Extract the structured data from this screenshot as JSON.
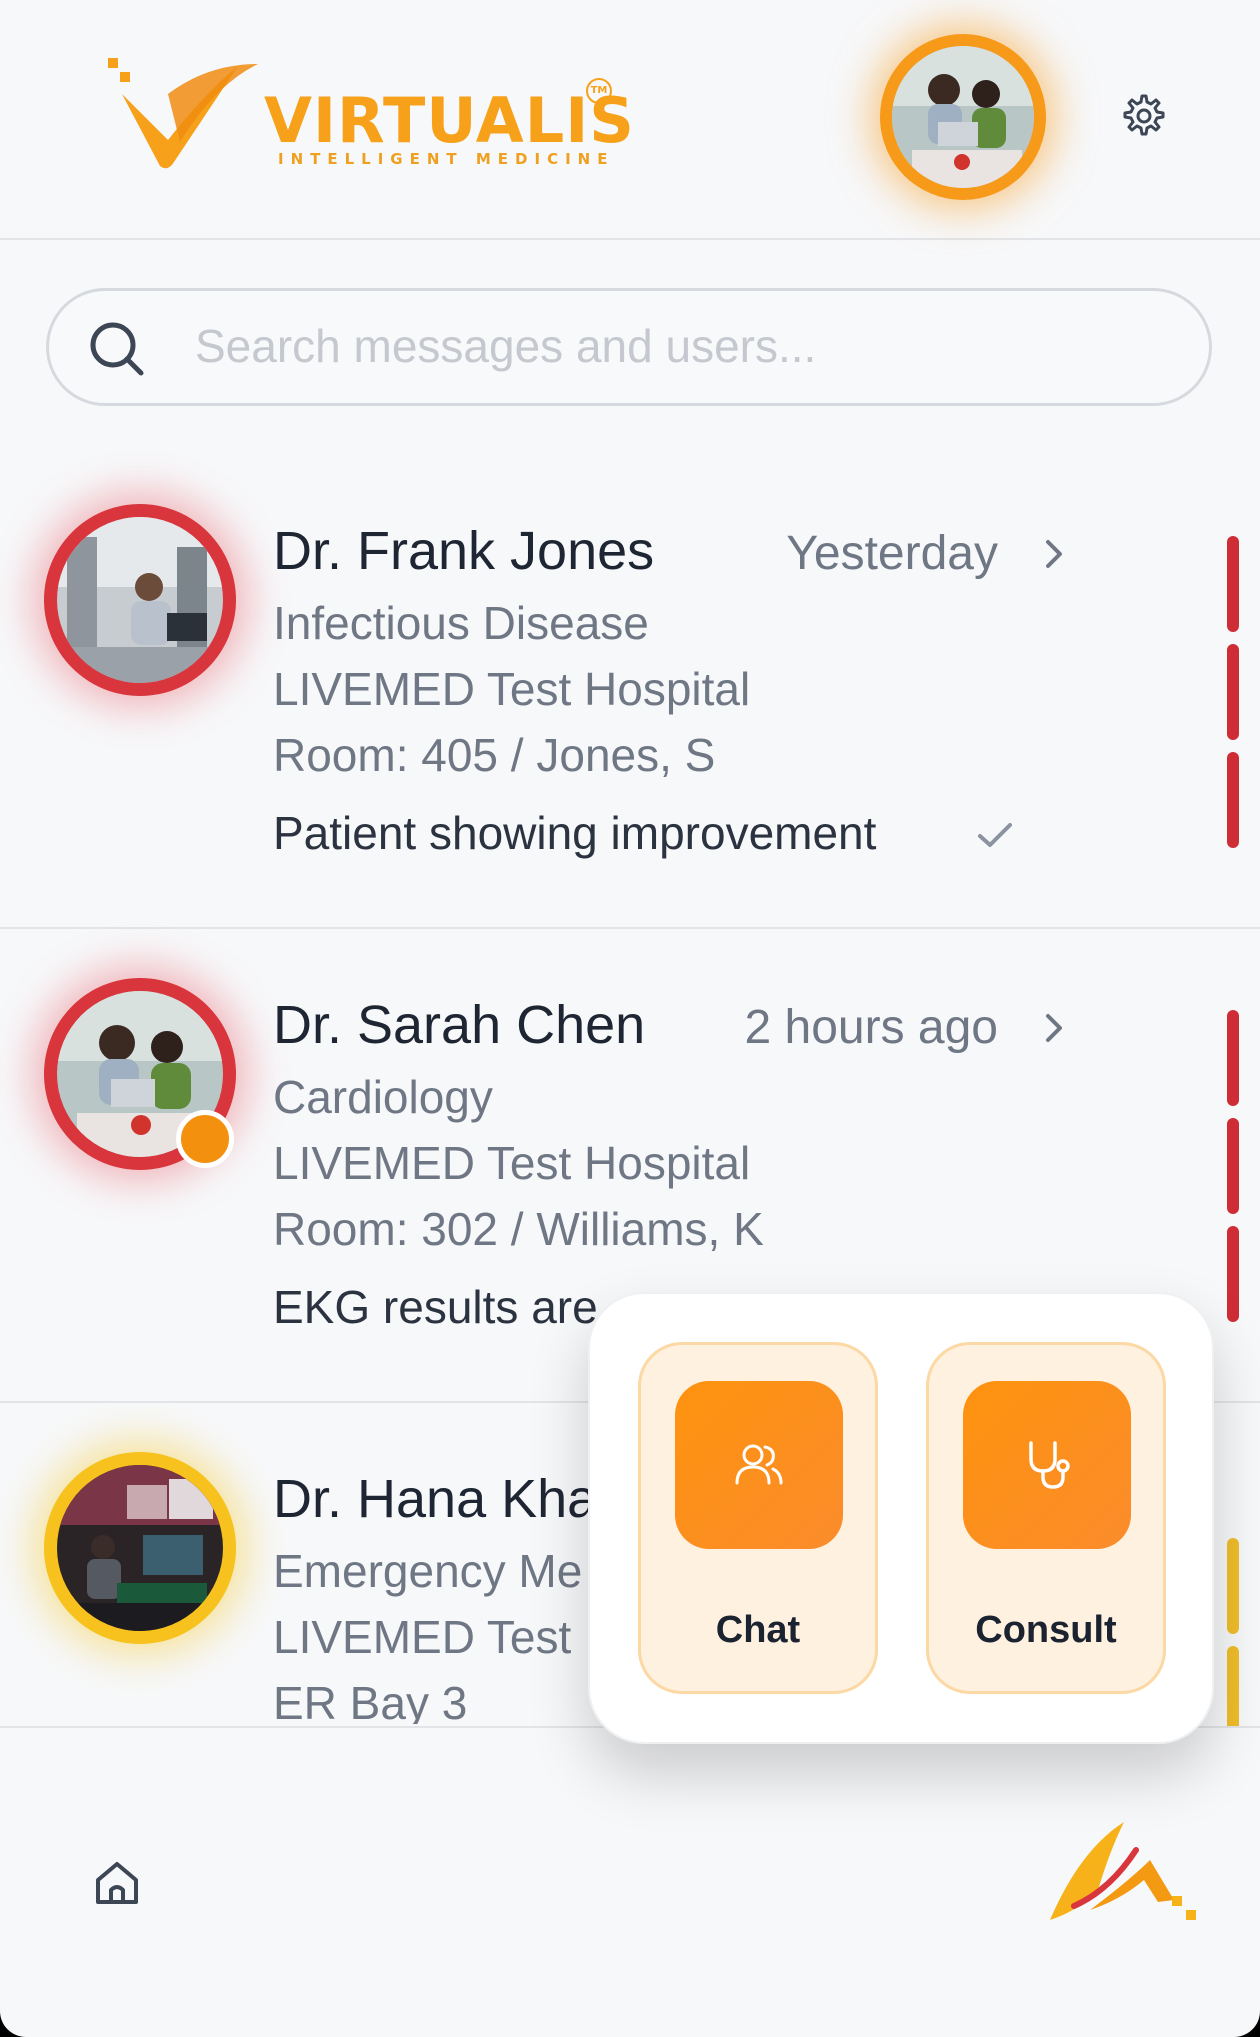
{
  "header": {
    "brand_name": "VIRTUALIS",
    "brand_tagline": "INTELLIGENT MEDICINE",
    "trademark": "TM",
    "avatar_icon": "user-photo",
    "settings_icon": "gear-icon"
  },
  "search": {
    "placeholder": "Search messages and users...",
    "icon": "search-icon"
  },
  "conversations": [
    {
      "name": "Dr. Frank Jones",
      "time": "Yesterday",
      "specialty": "Infectious Disease",
      "hospital": "LIVEMED Test Hospital",
      "location": "Room: 405 / Jones, S",
      "last_message": "Patient showing improvement",
      "read_check": true,
      "priority_color": "#d8353d"
    },
    {
      "name": "Dr. Sarah Chen",
      "time": "2 hours ago",
      "specialty": "Cardiology",
      "hospital": "LIVEMED Test Hospital",
      "location": "Room: 302 / Williams, K",
      "last_message": "EKG results are",
      "online_status_color": "#f3910f",
      "priority_color": "#d8353d"
    },
    {
      "name": "Dr. Hana Kha",
      "specialty": "Emergency Me",
      "hospital": "LIVEMED Test",
      "location": "ER Bay 3",
      "priority_color": "#f7c21e"
    }
  ],
  "popup_menu": {
    "chat_label": "Chat",
    "chat_icon": "users-icon",
    "consult_label": "Consult",
    "consult_icon": "stethoscope-icon"
  },
  "bottom_nav": {
    "home_icon": "home-icon",
    "brand_icon": "virtualis-mark-icon"
  },
  "colors": {
    "accent_orange": "#fe930e",
    "priority_red": "#d8353d",
    "priority_yellow": "#f7c21e"
  }
}
